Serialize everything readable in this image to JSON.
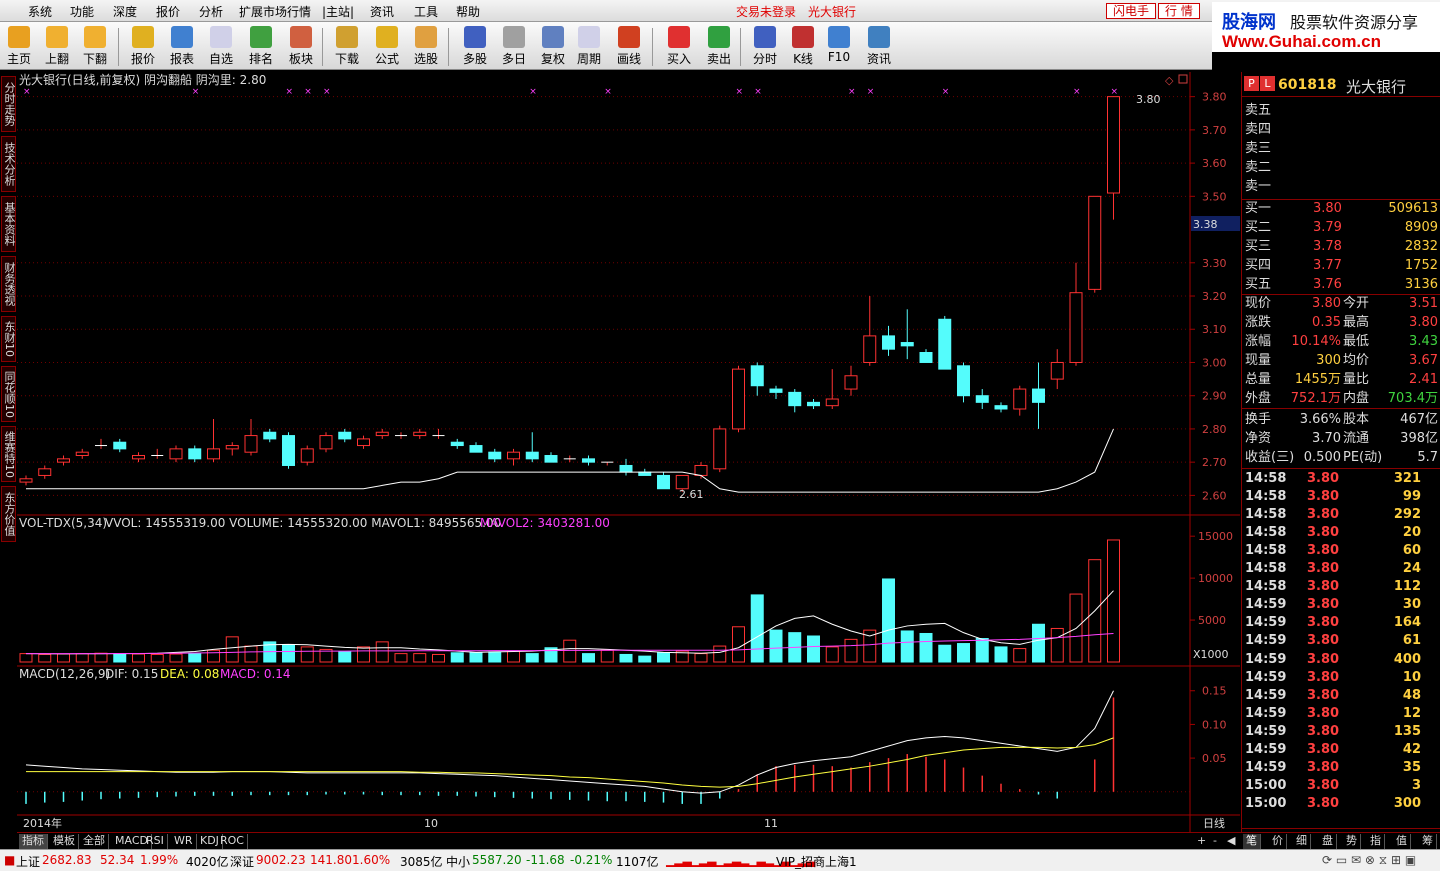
{
  "menu": {
    "items": [
      "系统",
      "功能",
      "深度",
      "报价",
      "分析",
      "扩展市场行情",
      "|主站|",
      "资讯",
      "工具",
      "帮助"
    ],
    "login_status": "交易未登录",
    "stock_name": "光大银行",
    "btn_flash": "闪电手",
    "btn_quote": "行 情"
  },
  "brand": {
    "line1": "股海网",
    "line1b": "股票软件资源分享",
    "line2": "Www.Guhai.com.cn"
  },
  "toolbar": [
    {
      "label": "主页",
      "icon": "home-icon",
      "color": "#e8a020"
    },
    {
      "label": "上翻",
      "icon": "arrow-up-icon",
      "color": "#f0b030"
    },
    {
      "label": "下翻",
      "icon": "arrow-down-icon",
      "color": "#f0b030"
    },
    {
      "label": "报价",
      "icon": "yen-icon",
      "color": "#e0b020"
    },
    {
      "label": "报表",
      "icon": "report-icon",
      "color": "#4080d0"
    },
    {
      "label": "自选",
      "icon": "f6-icon",
      "color": "#d0d0e8"
    },
    {
      "label": "排名",
      "icon": "rank-icon",
      "color": "#40a040"
    },
    {
      "label": "板块",
      "icon": "sector-icon",
      "color": "#d06040"
    },
    {
      "label": "下载",
      "icon": "download-icon",
      "color": "#d0a030"
    },
    {
      "label": "公式",
      "icon": "formula-icon",
      "color": "#e0b020"
    },
    {
      "label": "选股",
      "icon": "select-stock-icon",
      "color": "#e0a040"
    },
    {
      "label": "多股",
      "icon": "multi-stock-icon",
      "color": "#4060c0"
    },
    {
      "label": "多日",
      "icon": "multi-day-icon",
      "color": "#a0a0a0"
    },
    {
      "label": "复权",
      "icon": "restore-icon",
      "color": "#6080c0"
    },
    {
      "label": "周期",
      "icon": "f8-icon",
      "color": "#d0d0e8"
    },
    {
      "label": "画线",
      "icon": "draw-line-icon",
      "color": "#d04020"
    },
    {
      "label": "买入",
      "icon": "buy-icon",
      "color": "#e03030"
    },
    {
      "label": "卖出",
      "icon": "sell-icon",
      "color": "#30a040"
    },
    {
      "label": "分时",
      "icon": "intraday-icon",
      "color": "#4060c0"
    },
    {
      "label": "K线",
      "icon": "kline-icon",
      "color": "#c03030"
    },
    {
      "label": "F10",
      "icon": "f10-icon",
      "color": "#4080d0"
    },
    {
      "label": "资讯",
      "icon": "news-icon",
      "color": "#4080c0"
    }
  ],
  "left_tabs": [
    "分时走势",
    "技术分析",
    "基本资料",
    "财务透视",
    "东财10",
    "同花顺10",
    "维赛特10",
    "东方价值"
  ],
  "chart_header": {
    "title": "光大银行(日线,前复权) 阴沟翻船 阴沟里: 2.80",
    "vol_label": "VOL-TDX(5,34)",
    "vol_values": "VVOL: 14555319.00   VOLUME: 14555320.00   MAVOL1: 8495565.00",
    "mavol2": "MAVOL2: 3403281.00",
    "macd_label": "MACD(12,26,9)",
    "macd_dif": "DIF: 0.15",
    "macd_dea": "DEA: 0.08",
    "macd_val": "MACD: 0.14",
    "current_price_tag": "3.38",
    "high_annot": "3.80",
    "low_annot": "2.61",
    "x1000": "X1000",
    "x_labels": [
      "2014年",
      "10",
      "11"
    ],
    "period": "日线"
  },
  "chart_data": [
    {
      "type": "candlestick",
      "title": "光大银行(日线,前复权)",
      "ylim": [
        2.55,
        3.82
      ],
      "y_ticks": [
        2.6,
        2.7,
        2.8,
        2.9,
        3.0,
        3.1,
        3.2,
        3.3,
        3.5,
        3.6,
        3.7,
        3.8
      ],
      "ohlc": [
        [
          2.64,
          2.66,
          2.63,
          2.65
        ],
        [
          2.66,
          2.69,
          2.65,
          2.68
        ],
        [
          2.7,
          2.72,
          2.69,
          2.71
        ],
        [
          2.72,
          2.74,
          2.71,
          2.73
        ],
        [
          2.75,
          2.77,
          2.74,
          2.75
        ],
        [
          2.76,
          2.77,
          2.73,
          2.74
        ],
        [
          2.71,
          2.73,
          2.7,
          2.72
        ],
        [
          2.72,
          2.74,
          2.71,
          2.72
        ],
        [
          2.71,
          2.75,
          2.7,
          2.74
        ],
        [
          2.74,
          2.75,
          2.7,
          2.71
        ],
        [
          2.71,
          2.83,
          2.7,
          2.74
        ],
        [
          2.74,
          2.76,
          2.72,
          2.75
        ],
        [
          2.73,
          2.83,
          2.72,
          2.78
        ],
        [
          2.79,
          2.8,
          2.76,
          2.77
        ],
        [
          2.78,
          2.79,
          2.68,
          2.69
        ],
        [
          2.7,
          2.75,
          2.69,
          2.74
        ],
        [
          2.74,
          2.79,
          2.73,
          2.78
        ],
        [
          2.79,
          2.8,
          2.76,
          2.77
        ],
        [
          2.75,
          2.78,
          2.74,
          2.77
        ],
        [
          2.78,
          2.8,
          2.77,
          2.79
        ],
        [
          2.78,
          2.79,
          2.77,
          2.78
        ],
        [
          2.78,
          2.8,
          2.77,
          2.79
        ],
        [
          2.78,
          2.8,
          2.77,
          2.78
        ],
        [
          2.76,
          2.77,
          2.74,
          2.75
        ],
        [
          2.75,
          2.76,
          2.73,
          2.73
        ],
        [
          2.73,
          2.74,
          2.7,
          2.71
        ],
        [
          2.71,
          2.74,
          2.69,
          2.73
        ],
        [
          2.73,
          2.79,
          2.7,
          2.71
        ],
        [
          2.72,
          2.73,
          2.7,
          2.7
        ],
        [
          2.71,
          2.72,
          2.7,
          2.71
        ],
        [
          2.71,
          2.72,
          2.69,
          2.7
        ],
        [
          2.7,
          2.7,
          2.69,
          2.7
        ],
        [
          2.69,
          2.71,
          2.66,
          2.67
        ],
        [
          2.67,
          2.68,
          2.66,
          2.66
        ],
        [
          2.66,
          2.67,
          2.63,
          2.62
        ],
        [
          2.62,
          2.66,
          2.61,
          2.66
        ],
        [
          2.66,
          2.7,
          2.65,
          2.69
        ],
        [
          2.68,
          2.81,
          2.67,
          2.8
        ],
        [
          2.8,
          2.99,
          2.79,
          2.98
        ],
        [
          2.99,
          3.0,
          2.9,
          2.93
        ],
        [
          2.92,
          2.93,
          2.89,
          2.91
        ],
        [
          2.91,
          2.92,
          2.85,
          2.87
        ],
        [
          2.88,
          2.89,
          2.86,
          2.87
        ],
        [
          2.87,
          2.98,
          2.86,
          2.89
        ],
        [
          2.92,
          2.99,
          2.9,
          2.96
        ],
        [
          3.0,
          3.2,
          2.99,
          3.08
        ],
        [
          3.08,
          3.11,
          3.02,
          3.04
        ],
        [
          3.06,
          3.16,
          3.01,
          3.05
        ],
        [
          3.03,
          3.04,
          3.01,
          3.0
        ],
        [
          3.13,
          3.14,
          2.98,
          2.98
        ],
        [
          2.99,
          3.0,
          2.88,
          2.9
        ],
        [
          2.9,
          2.92,
          2.86,
          2.88
        ],
        [
          2.87,
          2.88,
          2.85,
          2.86
        ],
        [
          2.86,
          2.93,
          2.84,
          2.92
        ],
        [
          2.92,
          3.0,
          2.8,
          2.88
        ],
        [
          2.95,
          3.04,
          2.92,
          3.0
        ],
        [
          3.0,
          3.3,
          2.99,
          3.21
        ],
        [
          3.22,
          3.5,
          3.21,
          3.5
        ],
        [
          3.51,
          3.8,
          3.43,
          3.8
        ]
      ],
      "ma_line": [
        2.62,
        2.62,
        2.62,
        2.62,
        2.62,
        2.62,
        2.62,
        2.62,
        2.62,
        2.62,
        2.62,
        2.62,
        2.62,
        2.62,
        2.62,
        2.62,
        2.62,
        2.62,
        2.62,
        2.63,
        2.64,
        2.64,
        2.65,
        2.67,
        2.67,
        2.67,
        2.67,
        2.67,
        2.67,
        2.67,
        2.67,
        2.67,
        2.67,
        2.67,
        2.67,
        2.67,
        2.66,
        2.62,
        2.61,
        2.61,
        2.61,
        2.61,
        2.61,
        2.61,
        2.61,
        2.61,
        2.61,
        2.61,
        2.61,
        2.61,
        2.61,
        2.61,
        2.61,
        2.61,
        2.61,
        2.62,
        2.64,
        2.67,
        2.8
      ],
      "signal_marks_x": [
        0,
        9,
        14,
        15,
        16,
        27,
        31,
        38,
        39,
        44,
        45,
        49,
        56,
        58
      ]
    },
    {
      "type": "bar",
      "title": "VOL-TDX(5,34)",
      "ylim": [
        0,
        15500
      ],
      "y_ticks": [
        5000,
        10000,
        15000
      ],
      "values": [
        1000,
        900,
        950,
        1000,
        1050,
        1000,
        950,
        900,
        950,
        1050,
        1400,
        3000,
        1900,
        2400,
        2000,
        1800,
        1500,
        1200,
        1800,
        2400,
        1000,
        1000,
        900,
        1100,
        1100,
        1200,
        1300,
        1000,
        1700,
        2600,
        1000,
        1400,
        900,
        700,
        1100,
        1300,
        1000,
        1900,
        4200,
        8000,
        3800,
        3500,
        3100,
        1800,
        2700,
        3800,
        9900,
        3700,
        3400,
        2000,
        2200,
        2800,
        1800,
        1600,
        4500,
        4000,
        8100,
        12200,
        14550
      ],
      "mavol1": [
        1000,
        980,
        970,
        980,
        990,
        1000,
        1000,
        1050,
        1150,
        1250,
        1500,
        1700,
        1900,
        2050,
        2100,
        2050,
        1900,
        1750,
        1650,
        1700,
        1700,
        1550,
        1450,
        1300,
        1150,
        1200,
        1250,
        1300,
        1450,
        1600,
        1600,
        1500,
        1400,
        1300,
        1150,
        1100,
        1050,
        1150,
        1700,
        3000,
        4300,
        5200,
        5500,
        4500,
        3700,
        3100,
        3800,
        4300,
        4500,
        4600,
        3500,
        2700,
        2300,
        2100,
        2600,
        2900,
        4000,
        6100,
        8500
      ],
      "mavol2": [
        1000,
        1000,
        1000,
        1000,
        1000,
        1010,
        1020,
        1030,
        1050,
        1080,
        1100,
        1150,
        1200,
        1230,
        1250,
        1280,
        1300,
        1300,
        1320,
        1330,
        1330,
        1340,
        1340,
        1340,
        1340,
        1350,
        1350,
        1350,
        1360,
        1380,
        1390,
        1400,
        1400,
        1400,
        1400,
        1400,
        1400,
        1400,
        1450,
        1550,
        1650,
        1750,
        1850,
        1900,
        1950,
        2050,
        2250,
        2350,
        2450,
        2500,
        2550,
        2600,
        2650,
        2700,
        2800,
        2900,
        3050,
        3250,
        3400
      ]
    },
    {
      "type": "macd",
      "title": "MACD(12,26,9)",
      "ylim": [
        -0.03,
        0.16
      ],
      "y_ticks": [
        0.05,
        0.1,
        0.15
      ],
      "dif": [
        0.04,
        0.038,
        0.036,
        0.034,
        0.033,
        0.032,
        0.031,
        0.03,
        0.029,
        0.029,
        0.029,
        0.03,
        0.03,
        0.03,
        0.029,
        0.028,
        0.028,
        0.028,
        0.028,
        0.028,
        0.028,
        0.028,
        0.027,
        0.026,
        0.025,
        0.024,
        0.022,
        0.02,
        0.018,
        0.016,
        0.014,
        0.012,
        0.01,
        0.008,
        0.004,
        0.0,
        -0.002,
        0.0,
        0.01,
        0.025,
        0.036,
        0.042,
        0.046,
        0.049,
        0.052,
        0.06,
        0.068,
        0.076,
        0.08,
        0.082,
        0.08,
        0.076,
        0.072,
        0.068,
        0.064,
        0.06,
        0.066,
        0.094,
        0.15
      ],
      "dea": [
        0.03,
        0.03,
        0.03,
        0.03,
        0.03,
        0.03,
        0.03,
        0.03,
        0.03,
        0.03,
        0.03,
        0.03,
        0.03,
        0.03,
        0.03,
        0.03,
        0.03,
        0.03,
        0.03,
        0.03,
        0.03,
        0.029,
        0.029,
        0.028,
        0.028,
        0.027,
        0.026,
        0.025,
        0.024,
        0.022,
        0.021,
        0.019,
        0.017,
        0.015,
        0.013,
        0.01,
        0.008,
        0.007,
        0.008,
        0.012,
        0.017,
        0.022,
        0.026,
        0.03,
        0.034,
        0.038,
        0.043,
        0.048,
        0.054,
        0.058,
        0.062,
        0.064,
        0.066,
        0.066,
        0.066,
        0.065,
        0.066,
        0.07,
        0.08
      ],
      "hist": [
        -0.018,
        -0.016,
        -0.015,
        -0.013,
        -0.011,
        -0.01,
        -0.009,
        -0.008,
        -0.007,
        -0.006,
        -0.006,
        -0.006,
        -0.005,
        -0.005,
        -0.005,
        -0.005,
        -0.004,
        -0.004,
        -0.004,
        -0.005,
        -0.005,
        -0.005,
        -0.006,
        -0.006,
        -0.007,
        -0.008,
        -0.009,
        -0.01,
        -0.011,
        -0.012,
        -0.013,
        -0.014,
        -0.014,
        -0.015,
        -0.016,
        -0.018,
        -0.018,
        -0.01,
        0.004,
        0.026,
        0.038,
        0.04,
        0.04,
        0.038,
        0.036,
        0.044,
        0.05,
        0.056,
        0.052,
        0.048,
        0.036,
        0.024,
        0.012,
        0.004,
        -0.004,
        -0.01,
        0.0,
        0.048,
        0.14
      ]
    }
  ],
  "quote": {
    "code": "601818",
    "name": "光大银行",
    "sell": [
      "卖五",
      "卖四",
      "卖三",
      "卖二",
      "卖一"
    ],
    "buy": [
      {
        "label": "买一",
        "price": "3.80",
        "vol": "509613"
      },
      {
        "label": "买二",
        "price": "3.79",
        "vol": "8909"
      },
      {
        "label": "买三",
        "price": "3.78",
        "vol": "2832"
      },
      {
        "label": "买四",
        "price": "3.77",
        "vol": "1752"
      },
      {
        "label": "买五",
        "price": "3.76",
        "vol": "3136"
      }
    ],
    "stats": [
      {
        "l1": "现价",
        "v1": "3.80",
        "c1": "red",
        "l2": "今开",
        "v2": "3.51",
        "c2": "red"
      },
      {
        "l1": "涨跌",
        "v1": "0.35",
        "c1": "red",
        "l2": "最高",
        "v2": "3.80",
        "c2": "red"
      },
      {
        "l1": "涨幅",
        "v1": "10.14%",
        "c1": "red",
        "l2": "最低",
        "v2": "3.43",
        "c2": "grn"
      },
      {
        "l1": "现量",
        "v1": "300",
        "c1": "yel",
        "l2": "均价",
        "v2": "3.67",
        "c2": "red"
      },
      {
        "l1": "总量",
        "v1": "1455万",
        "c1": "yel",
        "l2": "量比",
        "v2": "2.41",
        "c2": "red"
      },
      {
        "l1": "外盘",
        "v1": "752.1万",
        "c1": "red",
        "l2": "内盘",
        "v2": "703.4万",
        "c2": "grn"
      }
    ],
    "fund": [
      {
        "l1": "换手",
        "v1": "3.66%",
        "l2": "股本",
        "v2": "467亿"
      },
      {
        "l1": "净资",
        "v1": "3.70",
        "l2": "流通",
        "v2": "398亿"
      },
      {
        "l1": "收益(三)",
        "v1": "0.500",
        "l2": "PE(动)",
        "v2": "5.7"
      }
    ],
    "ticks": [
      [
        "14:58",
        "3.80",
        "321"
      ],
      [
        "14:58",
        "3.80",
        "99"
      ],
      [
        "14:58",
        "3.80",
        "292"
      ],
      [
        "14:58",
        "3.80",
        "20"
      ],
      [
        "14:58",
        "3.80",
        "60"
      ],
      [
        "14:58",
        "3.80",
        "24"
      ],
      [
        "14:58",
        "3.80",
        "112"
      ],
      [
        "14:59",
        "3.80",
        "30"
      ],
      [
        "14:59",
        "3.80",
        "164"
      ],
      [
        "14:59",
        "3.80",
        "61"
      ],
      [
        "14:59",
        "3.80",
        "400"
      ],
      [
        "14:59",
        "3.80",
        "10"
      ],
      [
        "14:59",
        "3.80",
        "48"
      ],
      [
        "14:59",
        "3.80",
        "12"
      ],
      [
        "14:59",
        "3.80",
        "135"
      ],
      [
        "14:59",
        "3.80",
        "42"
      ],
      [
        "14:59",
        "3.80",
        "35"
      ],
      [
        "15:00",
        "3.80",
        "3"
      ],
      [
        "15:00",
        "3.80",
        "300"
      ]
    ],
    "bottom_tabs": [
      "笔",
      "价",
      "细",
      "盘",
      "势",
      "指",
      "值",
      "筹"
    ]
  },
  "indicator_tabs": [
    "指标",
    "模板",
    "全部",
    "MACD",
    "RSI",
    "WR",
    "KDJ",
    "ROC"
  ],
  "status": {
    "sh_label": "上证",
    "sh_val": "2682.83",
    "sh_chg": "52.34",
    "sh_pct": "1.99%",
    "sh_amt": "4020亿",
    "sz_label": "深证",
    "sz_val": "9002.23",
    "sz_chg": "141.80",
    "sz_pct": "1.60%",
    "sz_amt": "3085亿",
    "zx_label": "中小",
    "zx_val": "5587.20",
    "zx_chg": "-11.68",
    "zx_pct": "-0.21%",
    "zx_amt": "1107亿",
    "server": "VIP_招商上海1"
  },
  "colors": {
    "up": "#ff3232",
    "down": "#54fcfc",
    "frame": "#a00000",
    "white_line": "#ffffff",
    "mag": "#ff40ff",
    "yellow": "#ffff40"
  }
}
